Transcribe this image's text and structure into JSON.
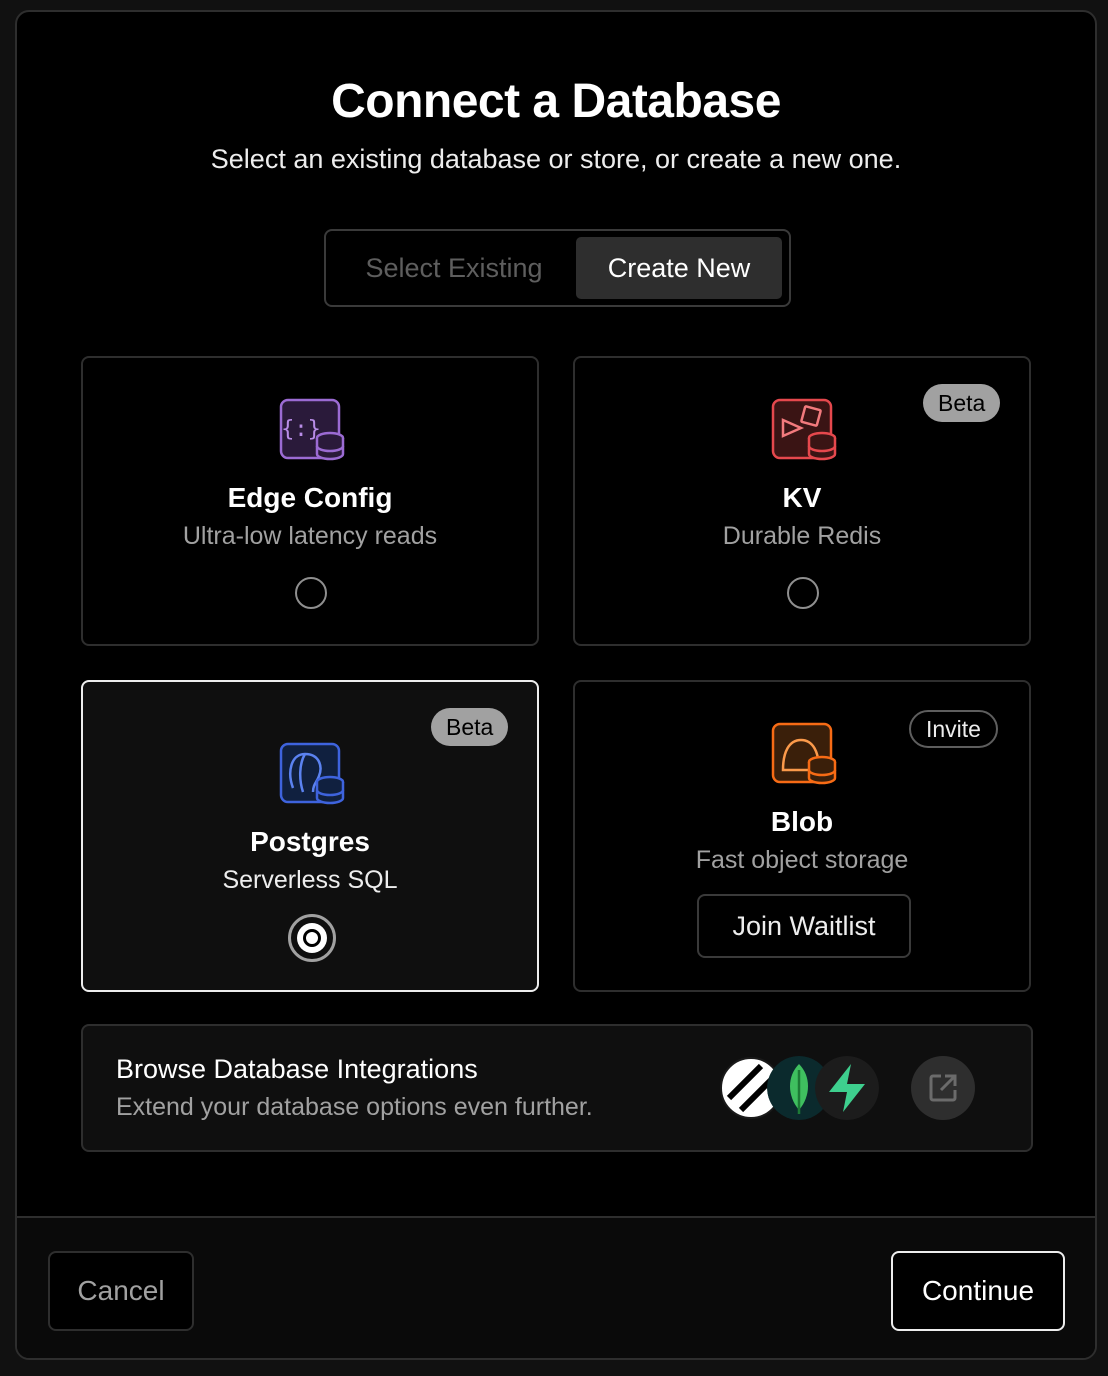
{
  "dialog": {
    "title": "Connect a Database",
    "subtitle": "Select an existing database or store, or create a new one."
  },
  "mode_toggle": {
    "options": [
      "Select Existing",
      "Create New"
    ],
    "selected": "Create New"
  },
  "cards": [
    {
      "name": "Edge Config",
      "description": "Ultra-low latency reads",
      "icon": "edge-config-icon",
      "accent": "#8e4ec6",
      "selected": false
    },
    {
      "name": "KV",
      "description": "Durable Redis",
      "icon": "kv-icon",
      "accent": "#e5484d",
      "badge": "Beta",
      "selected": false
    },
    {
      "name": "Postgres",
      "description": "Serverless SQL",
      "icon": "postgres-icon",
      "accent": "#3e63dd",
      "badge": "Beta",
      "selected": true
    },
    {
      "name": "Blob",
      "description": "Fast object storage",
      "icon": "blob-icon",
      "accent": "#f76b15",
      "badge": "Invite",
      "action": "Join Waitlist"
    }
  ],
  "integrations": {
    "title": "Browse Database Integrations",
    "description": "Extend your database options even further.",
    "logos": [
      "planetscale-logo",
      "mongodb-logo",
      "supabase-logo"
    ]
  },
  "footer": {
    "cancel_label": "Cancel",
    "continue_label": "Continue"
  }
}
